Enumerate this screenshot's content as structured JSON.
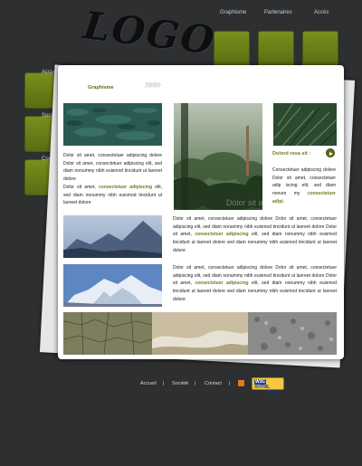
{
  "header": {
    "logo_text": "LOGO",
    "nav": [
      "Graphisme",
      "Partenaires",
      "Accès"
    ]
  },
  "side_menu": [
    "Accueil",
    "Société",
    "Contact"
  ],
  "main": {
    "breadcrumb": "Graphisme",
    "chevrons": "»»»",
    "col1_text_1": "Dolor sit amet, consectetuer adipiscing dolore Dolor sit amet, consectetuer adipiscing elit, sed diam nonummy nibh euismod tincidunt ut laoreet dolore",
    "col1_text_2a": "Dolor sit amet, ",
    "col1_text_2_hl": "consectetuer adipiscing",
    "col1_text_2b": " elit, sed diam nonummy nibh euismod tincidunt ut laoreet dolore",
    "forest_caption": "Dolor sit amet",
    "right_title": "Dolord rosa sit :",
    "right_text_a": "Consectetuer adipiscing dolore Dolor sit amet, consectetuer adip iscing elit, sed diam nonum my ",
    "right_text_hl": "consectetuer adipi.",
    "mid_text_1a": "Dolor sit amet, consectetuer adipiscing dolore Dolor sit amet, consectetuer adipiscing elit, sed diam nonummy nibh euismod tincidunt ut laoreet dolore Dolor sit amet, ",
    "mid_text_1_hl": "consectetuer adipiscing",
    "mid_text_1b": " elit, sed diam nonummy nibh euismod tincidunt ut laoreet dolore sed diam nonummy nibh euismod tincidunt ut laoreet dolore",
    "mid_text_2a": "Dolor sit amet, consectetuer adipiscing dolore Dolor sit amet, consectetuer adipiscing elit, sed diam nonummy nibh euismod tincidunt ut laoreet dolore Dolor sit amet, ",
    "mid_text_2_hl": "consectetuer adipiscing",
    "mid_text_2b": " elit, sed diam nonummy nibh euismod tincidunt ut laoreet dolore sed diam nonummy nibh euismod tincidunt ut laoreet dolore"
  },
  "footer": {
    "links": [
      "Accueil",
      "Société",
      "Contact"
    ],
    "separator": "|",
    "badge_w3c": "W3C",
    "badge_label": "XHTML",
    "badge_version": "1.0"
  },
  "colors": {
    "background": "#2d2f31",
    "accent_green": "#6c7d1f",
    "tile_green": "#6a7e18"
  }
}
